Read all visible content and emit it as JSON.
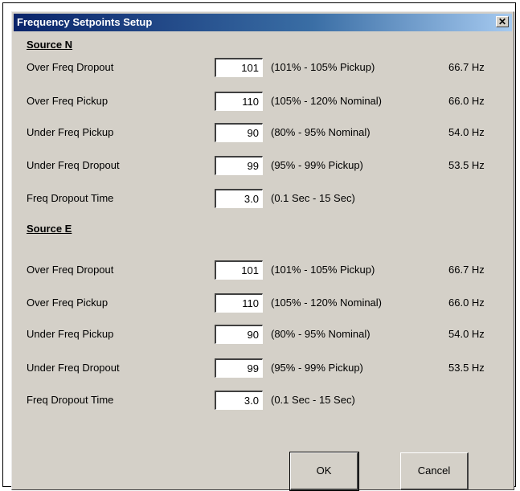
{
  "dialog": {
    "title": "Frequency Setpoints Setup",
    "close_label": "✕"
  },
  "sections": [
    {
      "heading": "Source N",
      "rows": [
        {
          "label": "Over Freq Dropout",
          "value": "101",
          "range": "(101% - 105% Pickup)",
          "hz": "66.7 Hz"
        },
        {
          "label": "Over Freq Pickup",
          "value": "110",
          "range": "(105% - 120% Nominal)",
          "hz": "66.0 Hz"
        },
        {
          "label": "Under Freq Pickup",
          "value": "90",
          "range": "(80% - 95% Nominal)",
          "hz": "54.0 Hz"
        },
        {
          "label": "Under Freq Dropout",
          "value": "99",
          "range": "(95% - 99% Pickup)",
          "hz": "53.5 Hz"
        },
        {
          "label": "Freq Dropout Time",
          "value": "3.0",
          "range": "(0.1 Sec - 15 Sec)",
          "hz": ""
        }
      ]
    },
    {
      "heading": "Source E",
      "rows": [
        {
          "label": "Over Freq Dropout",
          "value": "101",
          "range": "(101% - 105% Pickup)",
          "hz": "66.7 Hz"
        },
        {
          "label": "Over Freq Pickup",
          "value": "110",
          "range": "(105% - 120% Nominal)",
          "hz": "66.0 Hz"
        },
        {
          "label": "Under Freq Pickup",
          "value": "90",
          "range": "(80% - 95% Nominal)",
          "hz": "54.0 Hz"
        },
        {
          "label": "Under Freq Dropout",
          "value": "99",
          "range": "(95% - 99% Pickup)",
          "hz": "53.5 Hz"
        },
        {
          "label": "Freq Dropout Time",
          "value": "3.0",
          "range": "(0.1 Sec - 15 Sec)",
          "hz": ""
        }
      ]
    }
  ],
  "buttons": {
    "ok_label": "OK",
    "cancel_label": "Cancel"
  }
}
